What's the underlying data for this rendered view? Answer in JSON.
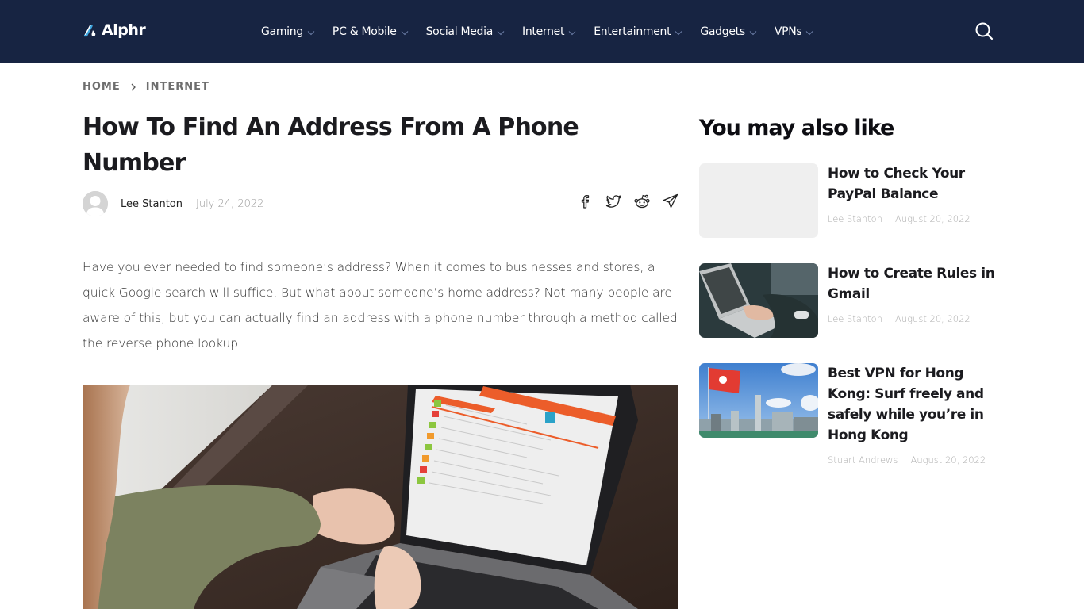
{
  "header": {
    "logo_text": "Alphr",
    "nav": [
      {
        "label": "Gaming"
      },
      {
        "label": "PC & Mobile"
      },
      {
        "label": "Social Media"
      },
      {
        "label": "Internet"
      },
      {
        "label": "Entertainment"
      },
      {
        "label": "Gadgets"
      },
      {
        "label": "VPNs"
      }
    ],
    "search_icon": "search-icon"
  },
  "breadcrumb": {
    "items": [
      "HOME",
      "INTERNET"
    ],
    "separator_icon": "chevron-right-icon"
  },
  "article": {
    "title": "How To Find An Address From A Phone Number",
    "author": "Lee Stanton",
    "date": "July 24, 2022",
    "share_icons": [
      "facebook-icon",
      "twitter-icon",
      "reddit-icon",
      "telegram-icon"
    ],
    "intro": "Have you ever needed to find someone’s address? When it comes to businesses and stores, a quick Google search will suffice. But what about someone’s home address? Not many people are aware of this, but you can actually find an address with a phone number through a method called the reverse phone lookup.",
    "hero_image_alt": "Person typing on a laptop showing a phone lookup website"
  },
  "sidebar": {
    "heading": "You may also like",
    "accent_color": "#4a7fc1",
    "cards": [
      {
        "title": "How to Check Your PayPal Balance",
        "author": "Lee Stanton",
        "date": "August 20, 2022",
        "thumb": "placeholder"
      },
      {
        "title": "How to Create Rules in Gmail",
        "author": "Lee Stanton",
        "date": "August 20, 2022",
        "thumb": "laptop-typing-photo"
      },
      {
        "title": "Best VPN for Hong Kong: Surf freely and safely while you’re in Hong Kong",
        "author": "Stuart Andrews",
        "date": "August 20, 2022",
        "thumb": "hong-kong-flag-skyline-photo"
      }
    ]
  },
  "colors": {
    "header_bg": "#172442",
    "text_dark": "#1b1b1f",
    "meta_gray": "#aeaeae"
  }
}
